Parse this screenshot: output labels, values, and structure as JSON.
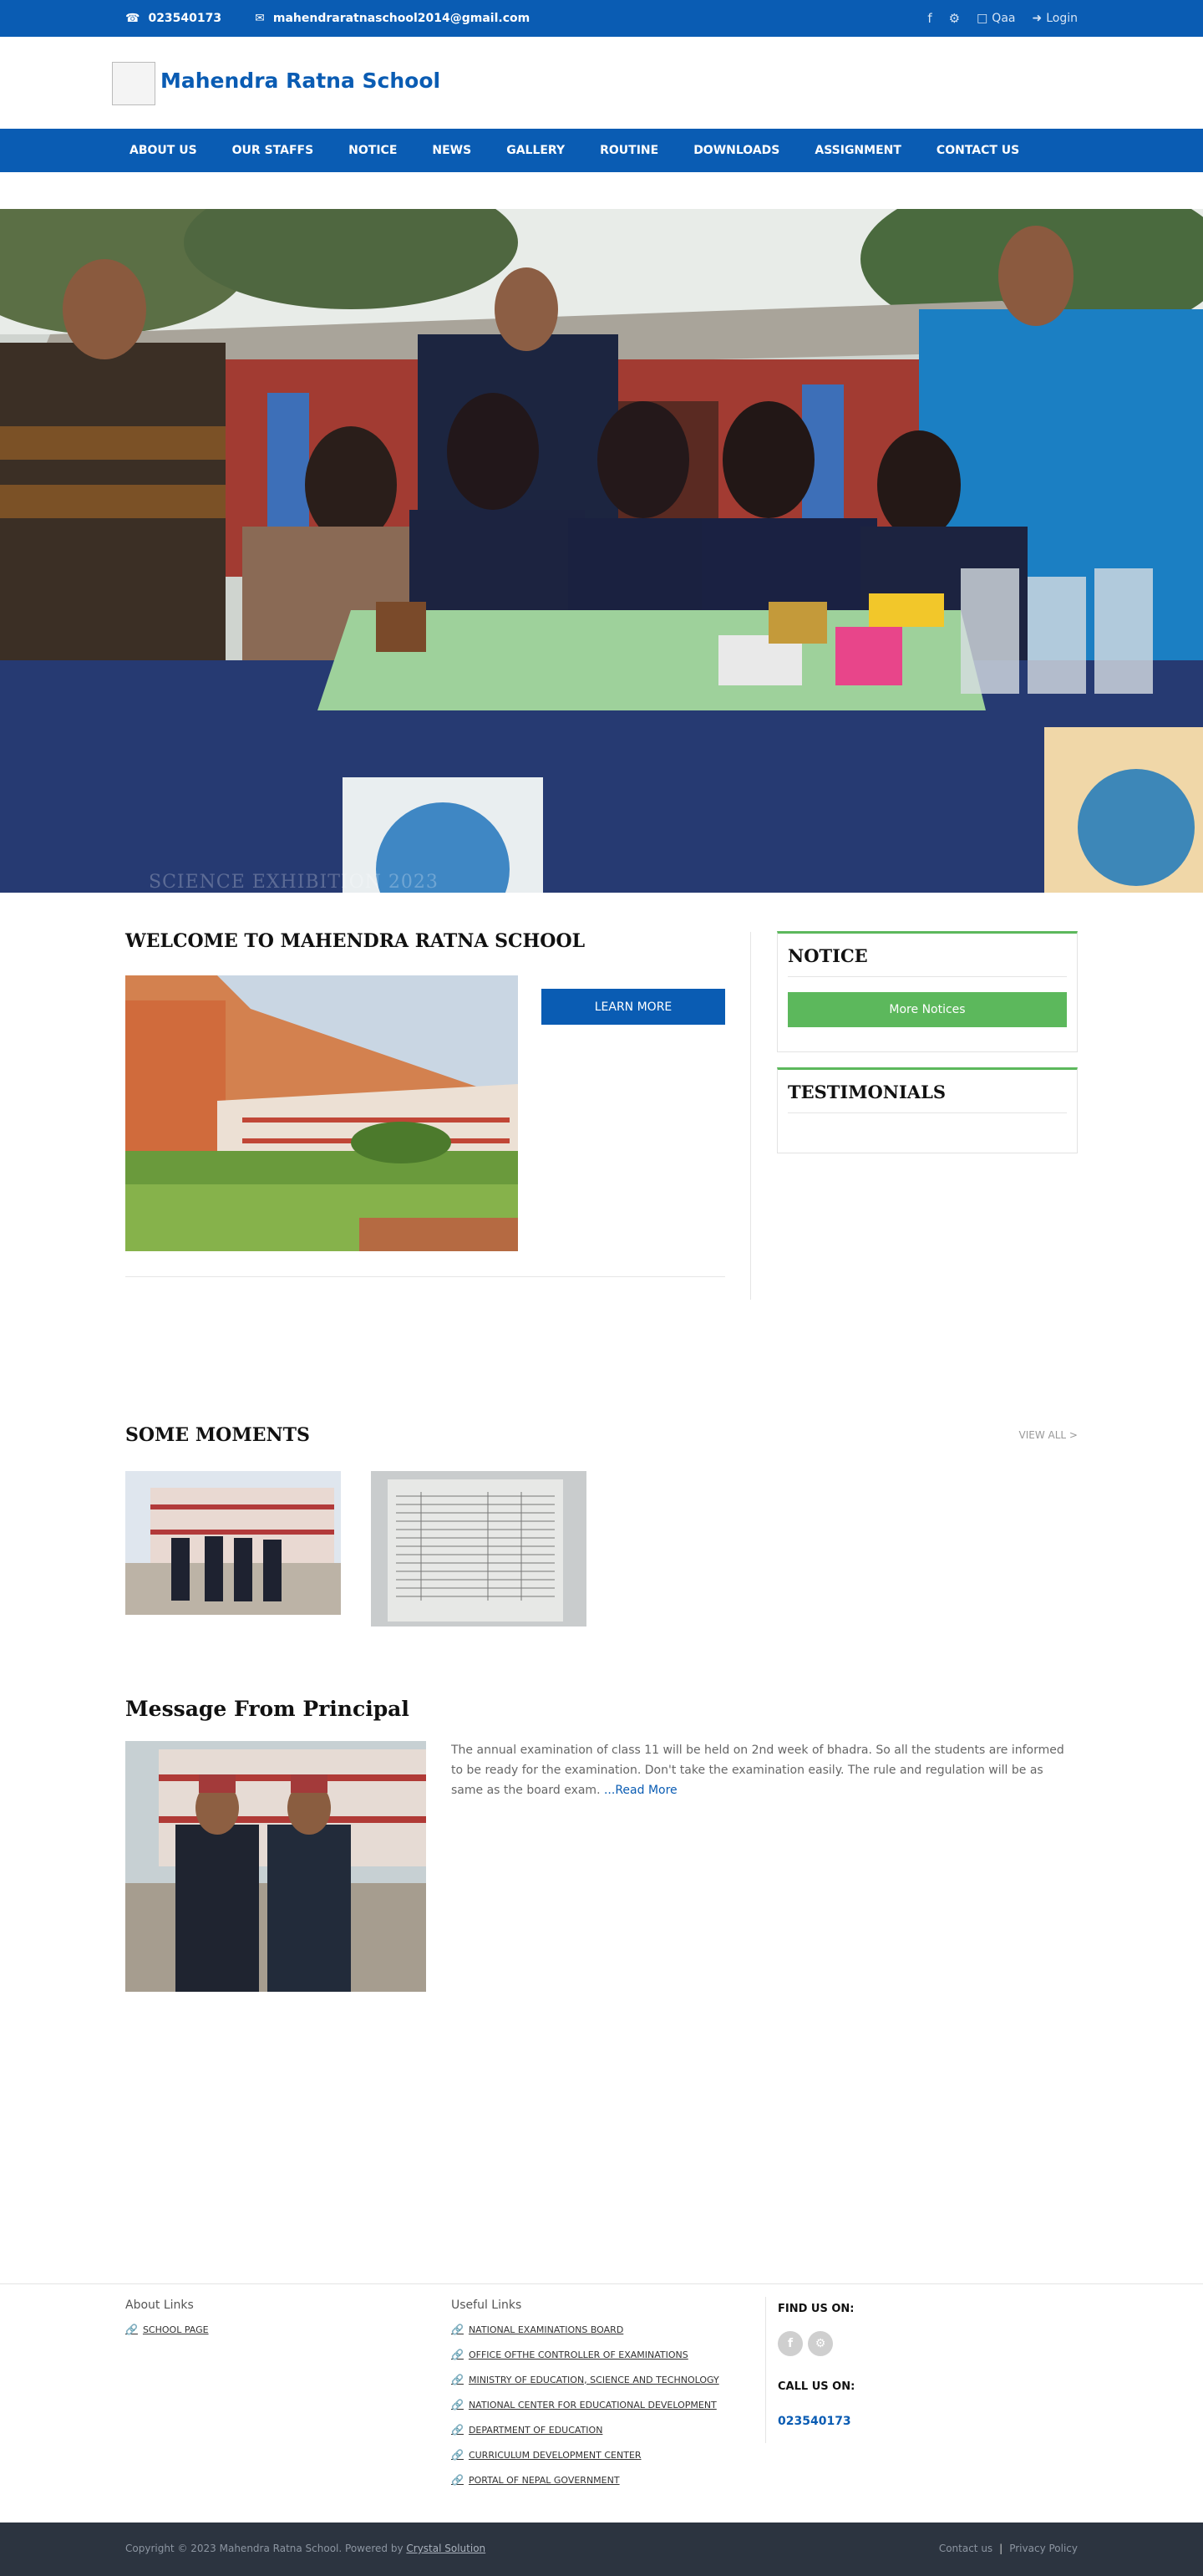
{
  "topbar": {
    "phone": "023540173",
    "email": "mahendraratnaschool2014@gmail.com",
    "qaa": "Qaa",
    "login": "Login",
    "icons": [
      "phone-icon",
      "envelope-icon",
      "facebook-icon",
      "android-icon",
      "document-icon",
      "sign-in-icon"
    ]
  },
  "header": {
    "site_title": "Mahendra Ratna School"
  },
  "nav": {
    "items": [
      "ABOUT US",
      "OUR STAFFS",
      "NOTICE",
      "NEWS",
      "GALLERY",
      "ROUTINE",
      "DOWNLOADS",
      "ASSIGNMENT",
      "CONTACT US"
    ]
  },
  "hero": {
    "caption": "SCIENCE EXHIBITION 2023"
  },
  "welcome": {
    "title": "WELCOME TO MAHENDRA RATNA SCHOOL",
    "button": "LEARN MORE"
  },
  "sidebar": {
    "notice_title": "NOTICE",
    "more_notices": "More Notices",
    "testimonials_title": "TESTIMONIALS"
  },
  "moments": {
    "title": "SOME MOMENTS",
    "view_all": "VIEW ALL >"
  },
  "principal": {
    "title": "Message From Principal",
    "text": "The annual examination of class 11 will be held on 2nd week of bhadra. So all the students are informed to be ready for the examination. Don't take the examination easily. The rule and regulation will be as same as the board exam.",
    "read_more": "...Read More"
  },
  "footer": {
    "about_title": "About Links",
    "about_links": [
      "SCHOOL PAGE"
    ],
    "useful_title": "Useful Links",
    "useful_links": [
      "NATIONAL EXAMINATIONS BOARD",
      "OFFICE OFTHE CONTROLLER OF EXAMINATIONS",
      "MINISTRY OF EDUCATION, SCIENCE AND TECHNOLOGY",
      "NATIONAL CENTER FOR EDUCATIONAL DEVELOPMENT",
      "DEPARTMENT OF EDUCATION",
      "CURRICULUM DEVELOPMENT CENTER",
      "PORTAL OF NEPAL GOVERNMENT"
    ],
    "find_us": "FIND US ON:",
    "call_us": "CALL US ON:",
    "phone": "023540173",
    "copyright_prefix": "Copyright © 2023 Mahendra Ratna School. Powered by",
    "powered_by": "Crystal Solution",
    "contact_us": "Contact us",
    "privacy": "Privacy Policy"
  },
  "colors": {
    "brand_blue": "#0a5cb3",
    "accent_green": "#5cb85c",
    "footer_dark": "#2c3440"
  }
}
